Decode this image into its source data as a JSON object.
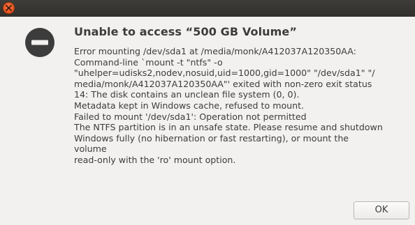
{
  "titlebar": {
    "close_icon": "close-icon"
  },
  "dialog": {
    "icon": "error-icon",
    "title": "Unable to access “500 GB Volume”",
    "message_lines": [
      "Error mounting /dev/sda1 at /media/monk/A412037A120350AA:",
      "Command-line `mount -t \"ntfs\" -o",
      "\"uhelper=udisks2,nodev,nosuid,uid=1000,gid=1000\" \"/dev/sda1\" \"/",
      "media/monk/A412037A120350AA\"' exited with non-zero exit status",
      "14: The disk contains an unclean file system (0, 0).",
      "Metadata kept in Windows cache, refused to mount.",
      "Failed to mount '/dev/sda1': Operation not permitted",
      "The NTFS partition is in an unsafe state. Please resume and shutdown",
      "Windows fully (no hibernation or fast restarting), or mount the",
      "volume",
      "read-only with the 'ro' mount option."
    ],
    "ok_label": "OK"
  },
  "colors": {
    "titlebar": "#3a3935",
    "close_button": "#e95420",
    "background": "#f2f1f0",
    "text": "#3c3c3c",
    "error_icon": "#3c3c3c"
  }
}
